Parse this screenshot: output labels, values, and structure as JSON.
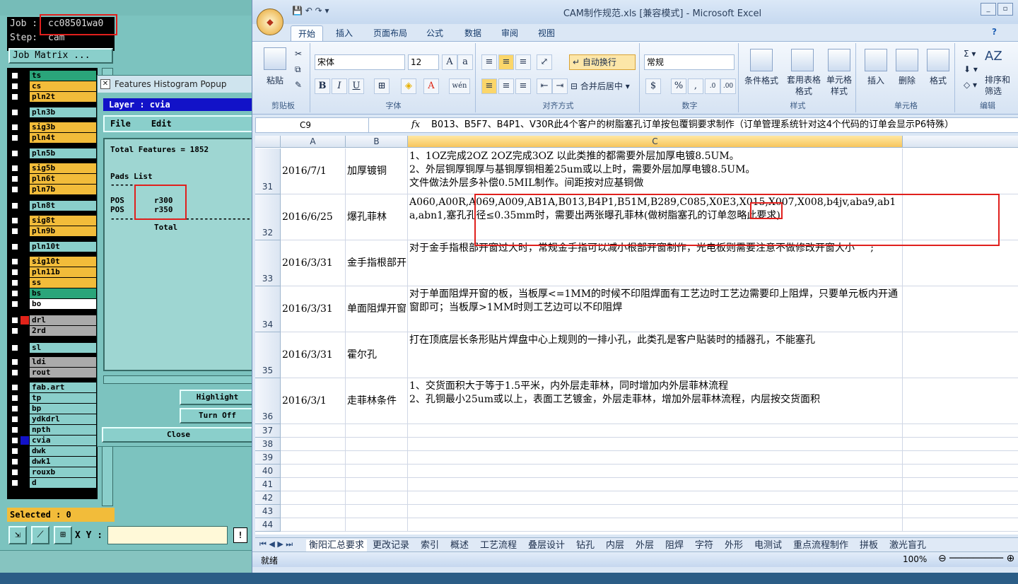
{
  "left_panel": {
    "job_label": "Job",
    "job_value": "cc08501wa0",
    "step_label": "Step:",
    "step_value": "cam",
    "job_matrix_button": "Job Matrix ...",
    "layers": [
      {
        "name": "ts",
        "color": "#2aa57a"
      },
      {
        "name": "cs",
        "color": "#f2bc3a"
      },
      {
        "name": "pln2t",
        "color": "#f2bc3a"
      },
      {
        "name": "pln3b",
        "color": "#8acfcb"
      },
      {
        "name": "sig3b",
        "color": "#f2bc3a"
      },
      {
        "name": "pln4t",
        "color": "#f2bc3a"
      },
      {
        "name": "pln5b",
        "color": "#8acfcb"
      },
      {
        "name": "sig5b",
        "color": "#f2bc3a"
      },
      {
        "name": "pln6t",
        "color": "#f2bc3a"
      },
      {
        "name": "pln7b",
        "color": "#f2bc3a"
      },
      {
        "name": "pln8t",
        "color": "#8acfcb"
      },
      {
        "name": "sig8t",
        "color": "#f2bc3a"
      },
      {
        "name": "pln9b",
        "color": "#f2bc3a"
      },
      {
        "name": "pln10t",
        "color": "#8acfcb"
      },
      {
        "name": "sig10t",
        "color": "#f2bc3a"
      },
      {
        "name": "pln11b",
        "color": "#f2bc3a"
      },
      {
        "name": "ss",
        "color": "#f2bc3a"
      },
      {
        "name": "bs",
        "color": "#2aa57a"
      },
      {
        "name": "bo",
        "color": "#ffffff"
      },
      {
        "name": "drl",
        "color": "#aaaaaa"
      },
      {
        "name": "2rd",
        "color": "#aaaaaa"
      },
      {
        "name": "sl",
        "color": "#8acfcb"
      },
      {
        "name": "ldi",
        "color": "#aaaaaa"
      },
      {
        "name": "rout",
        "color": "#aaaaaa"
      },
      {
        "name": "fab.art",
        "color": "#8acfcb"
      },
      {
        "name": "tp",
        "color": "#8acfcb"
      },
      {
        "name": "bp",
        "color": "#8acfcb"
      },
      {
        "name": "ydkdrl",
        "color": "#8acfcb"
      },
      {
        "name": "npth",
        "color": "#8acfcb"
      },
      {
        "name": "cvia",
        "color": "#8acfcb"
      },
      {
        "name": "dwk",
        "color": "#8acfcb"
      },
      {
        "name": "dwk1",
        "color": "#8acfcb"
      },
      {
        "name": "rouxb",
        "color": "#8acfcb"
      },
      {
        "name": "d",
        "color": "#8acfcb"
      }
    ],
    "selected_text": "Selected : 0",
    "xy_label": "X Y :",
    "excl": "!"
  },
  "popup": {
    "title": "Features Histogram Popup",
    "layer_text": "Layer :  cvia",
    "menu_file": "File",
    "menu_edit": "Edit",
    "total_features": "Total Features = 1852",
    "pads_list": "Pads List",
    "dashes": "---------",
    "rows": [
      {
        "pol": "POS",
        "sym": "r300"
      },
      {
        "pol": "POS",
        "sym": "r350"
      }
    ],
    "sep": "-------------------------------",
    "total": "Total",
    "highlight": "Highlight",
    "turn_off": "Turn Off",
    "close": "Close"
  },
  "excel": {
    "title": "CAM制作规范.xls  [兼容模式] - Microsoft Excel",
    "tabs": [
      "开始",
      "插入",
      "页面布局",
      "公式",
      "数据",
      "审阅",
      "视图"
    ],
    "groups": {
      "clipboard": "剪贴板",
      "paste": "粘贴",
      "font": "字体",
      "font_name": "宋体",
      "font_size": "12",
      "align": "对齐方式",
      "wrap": "自动换行",
      "merge": "合并后居中",
      "number": "数字",
      "number_format": "常规",
      "styles": "样式",
      "cond_format": "条件格式",
      "table_format": "套用表格格式",
      "cell_style": "单元格样式",
      "cells": "单元格",
      "insert": "插入",
      "delete": "删除",
      "format": "格式",
      "edit": "编辑",
      "sort": "排序和筛选"
    },
    "namebox": "C9",
    "fx": "fx",
    "formula": "B013、B5F7、B4P1、V30R此4个客户的树脂塞孔订单按包覆铜要求制作（订单管理系统针对这4个代码的订单会显示P6特殊）",
    "columns": [
      "A",
      "B",
      "C"
    ],
    "rows": [
      {
        "num": "31",
        "date": "2016/7/1",
        "title": "加厚镀铜",
        "text": "1、1OZ完成2OZ 2OZ完成3OZ 以此类推的都需要外层加厚电镀8.5UM。\n2、外层铜厚铜厚与基铜厚铜相差25um或以上时，需要外层加厚电镀8.5UM。\n文件做法外层多补偿0.5MIL制作。间距按对应基铜做"
      },
      {
        "num": "32",
        "date": "2016/6/25",
        "title": "爆孔菲林",
        "text": "A060,A00R,A069,A009,AB1A,B013,B4P1,B51M,B289,C085,X0E3,X015,X007,X008,b4jv,aba9,ab1a,abn1,塞孔孔径≤0.35mm时，需要出两张曝孔菲林(做树脂塞孔的订单忽略此要求)"
      },
      {
        "num": "33",
        "date": "2016/3/31",
        "title": "金手指根部开窗",
        "text": "对于金手指根部开窗过大时，常规金手指可以减小根部开窗制作，光电板则需要注意不做修改开窗大小     ;"
      },
      {
        "num": "34",
        "date": "2016/3/31",
        "title": "单面阻焊开窗",
        "text": "对于单面阻焊开窗的板，当板厚<=1MM的时候不印阻焊面有工艺边时工艺边需要印上阻焊，只要单元板内开通窗即可；当板厚>1MM时则工艺边可以不印阻焊"
      },
      {
        "num": "35",
        "date": "2016/3/31",
        "title": "霍尔孔",
        "text": "打在顶底层长条形贴片焊盘中心上规则的一排小孔，此类孔是客户贴装时的插器孔，不能塞孔"
      },
      {
        "num": "36",
        "date": "2016/3/1",
        "title": "走菲林条件",
        "text": "1、交货面积大于等于1.5平米，内外层走菲林，同时增加内外层菲林流程\n2、孔铜最小25um或以上，表面工艺镀金，外层走菲林，增加外层菲林流程，内层按交货面积"
      }
    ],
    "empty_rows": [
      "37",
      "38",
      "39",
      "40",
      "41",
      "42",
      "43",
      "44"
    ],
    "sheet_tabs": [
      "衡阳汇总要求",
      "更改记录",
      "索引",
      "概述",
      "工艺流程",
      "叠层设计",
      "钻孔",
      "内层",
      "外层",
      "阻焊",
      "字符",
      "外形",
      "电测试",
      "重点流程制作",
      "拼板",
      "激光盲孔"
    ],
    "status_ready": "就绪",
    "zoom": "100%"
  }
}
